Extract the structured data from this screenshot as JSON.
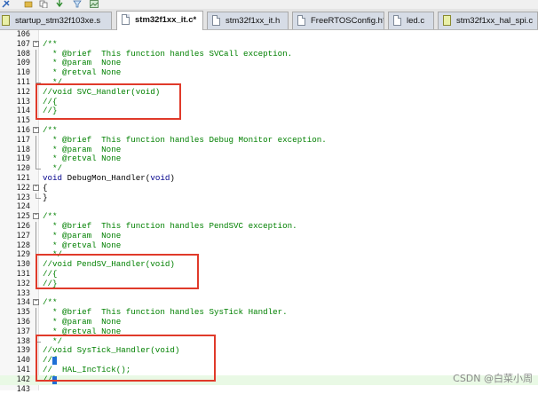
{
  "tabs": [
    {
      "label": "startup_stm32f103xe.s",
      "active": false
    },
    {
      "label": "stm32f1xx_it.c*",
      "active": true
    },
    {
      "label": "stm32f1xx_it.h",
      "active": false
    },
    {
      "label": "FreeRTOSConfig.h*",
      "active": false
    },
    {
      "label": "led.c",
      "active": false
    },
    {
      "label": "stm32f1xx_hal_spi.c",
      "active": false
    }
  ],
  "toolbar_icons": [
    "build-icon",
    "folder-icon",
    "copy-icon",
    "download-icon",
    "filter-icon",
    "image-icon"
  ],
  "lines": [
    {
      "n": "106",
      "t": ""
    },
    {
      "n": "107",
      "t": "/**"
    },
    {
      "n": "108",
      "t": "  * @brief  This function handles SVCall exception."
    },
    {
      "n": "109",
      "t": "  * @param  None"
    },
    {
      "n": "110",
      "t": "  * @retval None"
    },
    {
      "n": "111",
      "t": "  */"
    },
    {
      "n": "112",
      "t": "//void SVC_Handler(void)"
    },
    {
      "n": "113",
      "t": "//{"
    },
    {
      "n": "114",
      "t": "//}"
    },
    {
      "n": "115",
      "t": ""
    },
    {
      "n": "116",
      "t": "/**"
    },
    {
      "n": "117",
      "t": "  * @brief  This function handles Debug Monitor exception."
    },
    {
      "n": "118",
      "t": "  * @param  None"
    },
    {
      "n": "119",
      "t": "  * @retval None"
    },
    {
      "n": "120",
      "t": "  */"
    },
    {
      "n": "121",
      "t": "void DebugMon_Handler(void)"
    },
    {
      "n": "122",
      "t": "{"
    },
    {
      "n": "123",
      "t": "}"
    },
    {
      "n": "124",
      "t": ""
    },
    {
      "n": "125",
      "t": "/**"
    },
    {
      "n": "126",
      "t": "  * @brief  This function handles PendSVC exception."
    },
    {
      "n": "127",
      "t": "  * @param  None"
    },
    {
      "n": "128",
      "t": "  * @retval None"
    },
    {
      "n": "129",
      "t": "  */"
    },
    {
      "n": "130",
      "t": "//void PendSV_Handler(void)"
    },
    {
      "n": "131",
      "t": "//{"
    },
    {
      "n": "132",
      "t": "//}"
    },
    {
      "n": "133",
      "t": ""
    },
    {
      "n": "134",
      "t": "/**"
    },
    {
      "n": "135",
      "t": "  * @brief  This function handles SysTick Handler."
    },
    {
      "n": "136",
      "t": "  * @param  None"
    },
    {
      "n": "137",
      "t": "  * @retval None"
    },
    {
      "n": "138",
      "t": "  */"
    },
    {
      "n": "139",
      "t": "//void SysTick_Handler(void)"
    },
    {
      "n": "140",
      "t": "//{"
    },
    {
      "n": "141",
      "t": "//  HAL_IncTick();"
    },
    {
      "n": "142",
      "t": "//}"
    },
    {
      "n": "143",
      "t": ""
    }
  ],
  "watermark": "CSDN @白菜小周",
  "colors": {
    "comment": "#008000",
    "keyword": "#00008b",
    "highlight_box": "#e03a2a",
    "current_line": "#e9f9e5"
  }
}
